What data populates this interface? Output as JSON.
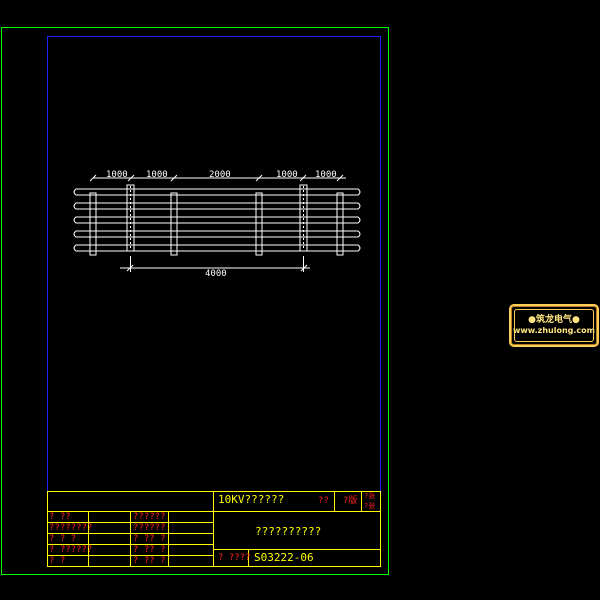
{
  "drawing": {
    "dimensions_top": [
      "1000",
      "1000",
      "2000",
      "1000",
      "1000"
    ],
    "dimension_bottom": "4000"
  },
  "title_block": {
    "project": "10KV??????",
    "drawing_name": "??????????",
    "drawing_number": "S03222-06",
    "code_label": "?    ????",
    "small_labels": {
      "a": "??",
      "b": "?版",
      "c": "?张",
      "d": "?张"
    },
    "left_rows": [
      {
        "c1": "?    ??",
        "c2": "??????"
      },
      {
        "c1": "????????",
        "c2": "??????"
      },
      {
        "c1": "?    ?    ?",
        "c2": "?    ??    ?"
      },
      {
        "c1": "?    ??????",
        "c2": "?    ??    ?"
      },
      {
        "c1": "?        ?",
        "c2": "?    ??    ?"
      }
    ]
  },
  "watermark": {
    "line1": "●筑龙电气●",
    "line2": "www.zhulong.com"
  },
  "colors": {
    "outer_frame": "#00ff00",
    "inner_frame": "#2020ff",
    "drawing": "#ffffff",
    "title_text": "#ffff00",
    "label_text": "#ff2020"
  }
}
